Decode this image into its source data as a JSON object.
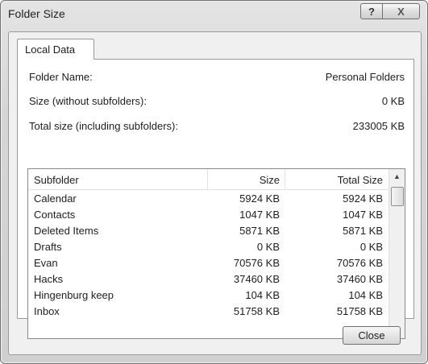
{
  "window": {
    "title": "Folder Size"
  },
  "titlebar": {
    "help_glyph": "?",
    "close_glyph": "X"
  },
  "tabs": [
    {
      "label": "Local Data"
    }
  ],
  "info": {
    "folder_name_label": "Folder Name:",
    "folder_name_value": "Personal Folders",
    "size_label": "Size (without subfolders):",
    "size_value": "0 KB",
    "total_label": "Total size (including subfolders):",
    "total_value": "233005 KB"
  },
  "table": {
    "columns": [
      "Subfolder",
      "Size",
      "Total Size"
    ],
    "rows": [
      {
        "name": "Calendar",
        "size": "5924 KB",
        "total": "5924 KB"
      },
      {
        "name": "Contacts",
        "size": "1047 KB",
        "total": "1047 KB"
      },
      {
        "name": "Deleted Items",
        "size": "5871 KB",
        "total": "5871 KB"
      },
      {
        "name": "Drafts",
        "size": "0 KB",
        "total": "0 KB"
      },
      {
        "name": "Evan",
        "size": "70576 KB",
        "total": "70576 KB"
      },
      {
        "name": "Hacks",
        "size": "37460 KB",
        "total": "37460 KB"
      },
      {
        "name": "Hingenburg keep",
        "size": "104 KB",
        "total": "104 KB"
      },
      {
        "name": "Inbox",
        "size": "51758 KB",
        "total": "51758 KB"
      }
    ]
  },
  "buttons": {
    "close_label": "Close"
  }
}
